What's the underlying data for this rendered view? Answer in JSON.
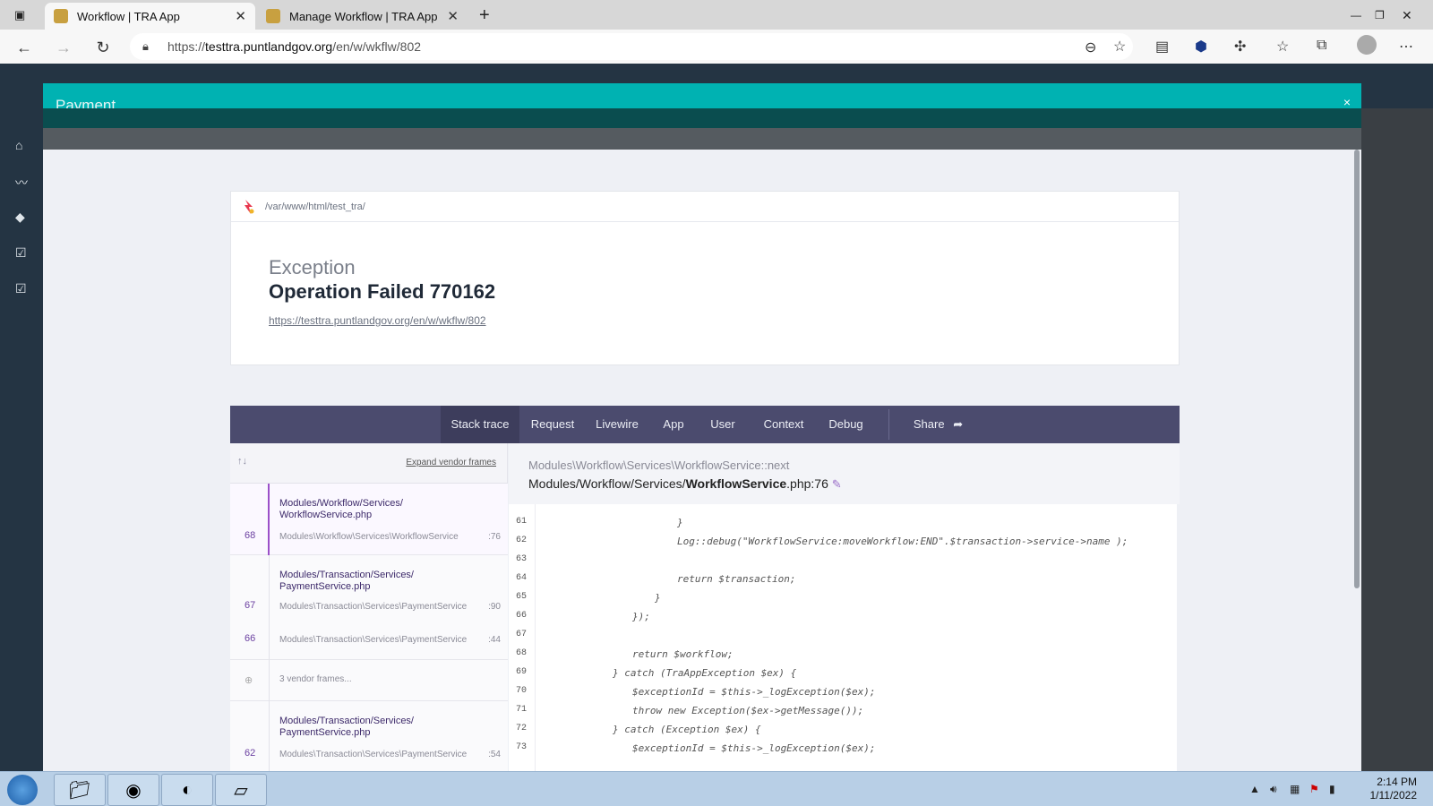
{
  "browser": {
    "tabs": [
      {
        "title": "Workflow | TRA App",
        "active": true
      },
      {
        "title": "Manage Workflow | TRA App",
        "active": false
      }
    ],
    "new_tab": "+",
    "url_host": "testtra.puntlandgov.org",
    "url_scheme": "https://",
    "url_path": "/en/w/wkflw/802"
  },
  "modal": {
    "title": "Payment",
    "close": "×"
  },
  "error": {
    "path": "/var/www/html/test_tra/",
    "type": "Exception",
    "message": "Operation Failed 770162",
    "url": "https://testtra.puntlandgov.org/en/w/wkflw/802",
    "tabs": [
      "Stack trace",
      "Request",
      "Livewire",
      "App",
      "User",
      "Context",
      "Debug",
      "Share"
    ],
    "expand_vendor": "Expand vendor frames",
    "frames": [
      {
        "num": "68",
        "file1": "Modules/Workflow/Services/",
        "file2": "WorkflowService.php",
        "cls": "Modules\\Workflow\\Services\\WorkflowService",
        "line": ":76"
      },
      {
        "num": "67",
        "file1": "Modules/Transaction/Services/",
        "file2": "PaymentService.php",
        "cls": "Modules\\Transaction\\Services\\PaymentService",
        "line": ":90"
      },
      {
        "num": "66",
        "cls": "Modules\\Transaction\\Services\\PaymentService",
        "line": ":44"
      },
      {
        "vendor": "3 vendor frames..."
      },
      {
        "num": "62",
        "file1": "Modules/Transaction/Services/",
        "file2": "PaymentService.php",
        "cls": "Modules\\Transaction\\Services\\PaymentService",
        "line": ":54"
      }
    ],
    "code_class": "Modules\\Workflow\\Services\\WorkflowService::next",
    "code_file_prefix": "Modules/Workflow/Services/",
    "code_file_name": "WorkflowService",
    "code_file_suffix": ".php:76",
    "code_lines": [
      {
        "n": "61",
        "text": "}"
      },
      {
        "n": "62",
        "text": "Log::debug(\"WorkflowService:moveWorkflow:END\".$transaction->service->name );"
      },
      {
        "n": "63",
        "text": ""
      },
      {
        "n": "64",
        "text": "return $transaction;"
      },
      {
        "n": "65",
        "text": "}"
      },
      {
        "n": "66",
        "text": "});"
      },
      {
        "n": "67",
        "text": ""
      },
      {
        "n": "68",
        "text": "return $workflow;"
      },
      {
        "n": "69",
        "text": "} catch (TraAppException $ex) {"
      },
      {
        "n": "70",
        "text": "$exceptionId = $this->_logException($ex);"
      },
      {
        "n": "71",
        "text": "throw new Exception($ex->getMessage());"
      },
      {
        "n": "72",
        "text": "} catch (Exception $ex) {"
      },
      {
        "n": "73",
        "text": "$exceptionId = $this->_logException($ex);"
      }
    ]
  },
  "taskbar": {
    "time": "2:14 PM",
    "date": "1/11/2022"
  }
}
